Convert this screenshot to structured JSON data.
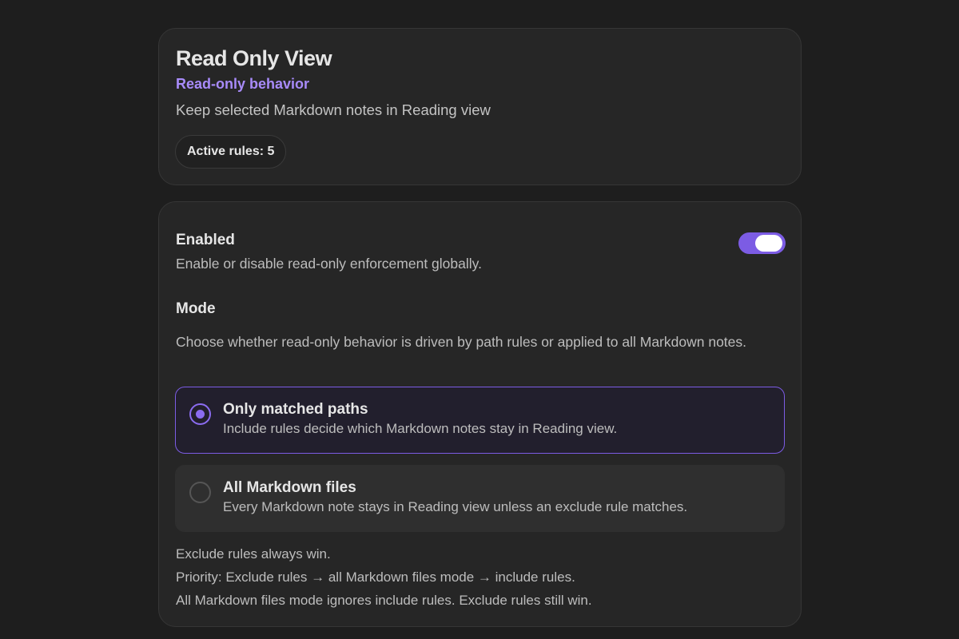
{
  "header": {
    "title": "Read Only View",
    "subtitle": "Read-only behavior",
    "description": "Keep selected Markdown notes in Reading view",
    "active_rules_label": "Active rules: 5"
  },
  "settings": {
    "enabled": {
      "name": "Enabled",
      "description": "Enable or disable read-only enforcement globally.",
      "value": true
    },
    "mode": {
      "name": "Mode",
      "description": "Choose whether read-only behavior is driven by path rules or applied to all Markdown notes.",
      "options": [
        {
          "title": "Only matched paths",
          "description": "Include rules decide which Markdown notes stay in Reading view.",
          "selected": true
        },
        {
          "title": "All Markdown files",
          "description": "Every Markdown note stays in Reading view unless an exclude rule matches.",
          "selected": false
        }
      ]
    },
    "notes": [
      "Exclude rules always win.",
      "Priority: Exclude rules → all Markdown files mode → include rules.",
      "All Markdown files mode ignores include rules. Exclude rules still win."
    ]
  },
  "colors": {
    "accent": "#7c5ce4",
    "subtitle": "#a88bfa",
    "background": "#1e1e1e",
    "card": "#262626"
  }
}
